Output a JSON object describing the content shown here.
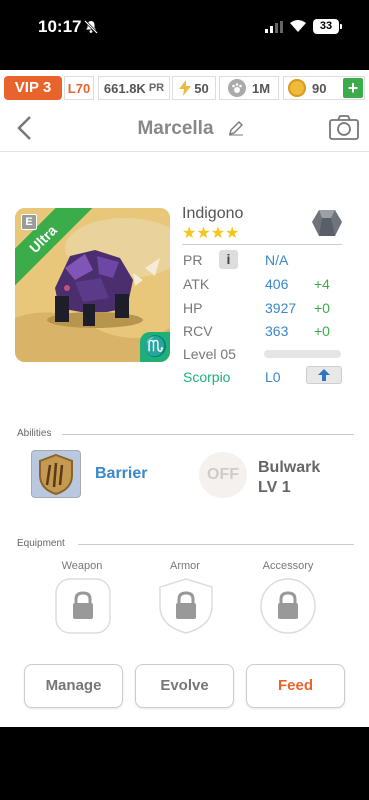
{
  "status": {
    "time": "10:17",
    "battery": "33"
  },
  "resources": {
    "vip": "VIP 3",
    "level": "L70",
    "power": "661.8K",
    "power_unit": "PR",
    "energy": "50",
    "food": "1M",
    "gold": "90"
  },
  "header": {
    "title": "Marcella"
  },
  "monster": {
    "name": "Indigono",
    "rarity": "Ultra",
    "stars": 4,
    "element_badge": "E",
    "zodiac_symbol": "♏",
    "stats": {
      "pr_label": "PR",
      "pr_value": "N/A",
      "info": "i",
      "atk_label": "ATK",
      "atk_value": "406",
      "atk_bonus": "+4",
      "hp_label": "HP",
      "hp_value": "3927",
      "hp_bonus": "+0",
      "rcv_label": "RCV",
      "rcv_value": "363",
      "rcv_bonus": "+0",
      "level_label": "Level 05",
      "level_progress": 0,
      "zodiac_label": "Scorpio",
      "zodiac_level": "L0"
    },
    "colors": {
      "stat_value": "#3a87c9",
      "bonus": "#3aac4a",
      "zodiac": "#1fb07a"
    }
  },
  "abilities": {
    "section_label": "Abilities",
    "items": [
      {
        "name": "Barrier"
      },
      {
        "name": "Bulwark",
        "level": "LV 1",
        "state": "OFF"
      }
    ]
  },
  "equipment": {
    "section_label": "Equipment",
    "slots": [
      "Weapon",
      "Armor",
      "Accessory"
    ]
  },
  "actions": {
    "manage": "Manage",
    "evolve": "Evolve",
    "feed": "Feed"
  }
}
